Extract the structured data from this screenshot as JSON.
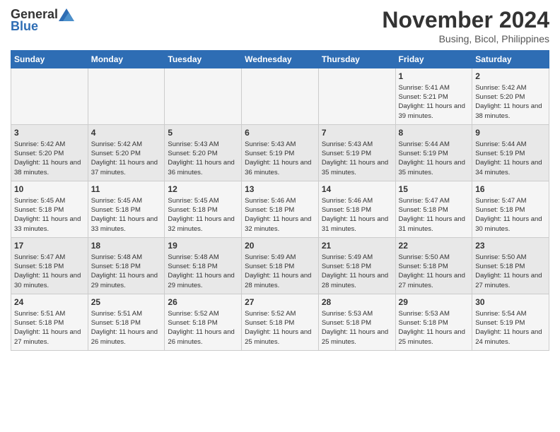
{
  "header": {
    "logo_general": "General",
    "logo_blue": "Blue",
    "month_title": "November 2024",
    "location": "Busing, Bicol, Philippines"
  },
  "days_of_week": [
    "Sunday",
    "Monday",
    "Tuesday",
    "Wednesday",
    "Thursday",
    "Friday",
    "Saturday"
  ],
  "weeks": [
    [
      {
        "day": "",
        "sunrise": "",
        "sunset": "",
        "daylight": ""
      },
      {
        "day": "",
        "sunrise": "",
        "sunset": "",
        "daylight": ""
      },
      {
        "day": "",
        "sunrise": "",
        "sunset": "",
        "daylight": ""
      },
      {
        "day": "",
        "sunrise": "",
        "sunset": "",
        "daylight": ""
      },
      {
        "day": "",
        "sunrise": "",
        "sunset": "",
        "daylight": ""
      },
      {
        "day": "1",
        "sunrise": "Sunrise: 5:41 AM",
        "sunset": "Sunset: 5:21 PM",
        "daylight": "Daylight: 11 hours and 39 minutes."
      },
      {
        "day": "2",
        "sunrise": "Sunrise: 5:42 AM",
        "sunset": "Sunset: 5:20 PM",
        "daylight": "Daylight: 11 hours and 38 minutes."
      }
    ],
    [
      {
        "day": "3",
        "sunrise": "Sunrise: 5:42 AM",
        "sunset": "Sunset: 5:20 PM",
        "daylight": "Daylight: 11 hours and 38 minutes."
      },
      {
        "day": "4",
        "sunrise": "Sunrise: 5:42 AM",
        "sunset": "Sunset: 5:20 PM",
        "daylight": "Daylight: 11 hours and 37 minutes."
      },
      {
        "day": "5",
        "sunrise": "Sunrise: 5:43 AM",
        "sunset": "Sunset: 5:20 PM",
        "daylight": "Daylight: 11 hours and 36 minutes."
      },
      {
        "day": "6",
        "sunrise": "Sunrise: 5:43 AM",
        "sunset": "Sunset: 5:19 PM",
        "daylight": "Daylight: 11 hours and 36 minutes."
      },
      {
        "day": "7",
        "sunrise": "Sunrise: 5:43 AM",
        "sunset": "Sunset: 5:19 PM",
        "daylight": "Daylight: 11 hours and 35 minutes."
      },
      {
        "day": "8",
        "sunrise": "Sunrise: 5:44 AM",
        "sunset": "Sunset: 5:19 PM",
        "daylight": "Daylight: 11 hours and 35 minutes."
      },
      {
        "day": "9",
        "sunrise": "Sunrise: 5:44 AM",
        "sunset": "Sunset: 5:19 PM",
        "daylight": "Daylight: 11 hours and 34 minutes."
      }
    ],
    [
      {
        "day": "10",
        "sunrise": "Sunrise: 5:45 AM",
        "sunset": "Sunset: 5:18 PM",
        "daylight": "Daylight: 11 hours and 33 minutes."
      },
      {
        "day": "11",
        "sunrise": "Sunrise: 5:45 AM",
        "sunset": "Sunset: 5:18 PM",
        "daylight": "Daylight: 11 hours and 33 minutes."
      },
      {
        "day": "12",
        "sunrise": "Sunrise: 5:45 AM",
        "sunset": "Sunset: 5:18 PM",
        "daylight": "Daylight: 11 hours and 32 minutes."
      },
      {
        "day": "13",
        "sunrise": "Sunrise: 5:46 AM",
        "sunset": "Sunset: 5:18 PM",
        "daylight": "Daylight: 11 hours and 32 minutes."
      },
      {
        "day": "14",
        "sunrise": "Sunrise: 5:46 AM",
        "sunset": "Sunset: 5:18 PM",
        "daylight": "Daylight: 11 hours and 31 minutes."
      },
      {
        "day": "15",
        "sunrise": "Sunrise: 5:47 AM",
        "sunset": "Sunset: 5:18 PM",
        "daylight": "Daylight: 11 hours and 31 minutes."
      },
      {
        "day": "16",
        "sunrise": "Sunrise: 5:47 AM",
        "sunset": "Sunset: 5:18 PM",
        "daylight": "Daylight: 11 hours and 30 minutes."
      }
    ],
    [
      {
        "day": "17",
        "sunrise": "Sunrise: 5:47 AM",
        "sunset": "Sunset: 5:18 PM",
        "daylight": "Daylight: 11 hours and 30 minutes."
      },
      {
        "day": "18",
        "sunrise": "Sunrise: 5:48 AM",
        "sunset": "Sunset: 5:18 PM",
        "daylight": "Daylight: 11 hours and 29 minutes."
      },
      {
        "day": "19",
        "sunrise": "Sunrise: 5:48 AM",
        "sunset": "Sunset: 5:18 PM",
        "daylight": "Daylight: 11 hours and 29 minutes."
      },
      {
        "day": "20",
        "sunrise": "Sunrise: 5:49 AM",
        "sunset": "Sunset: 5:18 PM",
        "daylight": "Daylight: 11 hours and 28 minutes."
      },
      {
        "day": "21",
        "sunrise": "Sunrise: 5:49 AM",
        "sunset": "Sunset: 5:18 PM",
        "daylight": "Daylight: 11 hours and 28 minutes."
      },
      {
        "day": "22",
        "sunrise": "Sunrise: 5:50 AM",
        "sunset": "Sunset: 5:18 PM",
        "daylight": "Daylight: 11 hours and 27 minutes."
      },
      {
        "day": "23",
        "sunrise": "Sunrise: 5:50 AM",
        "sunset": "Sunset: 5:18 PM",
        "daylight": "Daylight: 11 hours and 27 minutes."
      }
    ],
    [
      {
        "day": "24",
        "sunrise": "Sunrise: 5:51 AM",
        "sunset": "Sunset: 5:18 PM",
        "daylight": "Daylight: 11 hours and 27 minutes."
      },
      {
        "day": "25",
        "sunrise": "Sunrise: 5:51 AM",
        "sunset": "Sunset: 5:18 PM",
        "daylight": "Daylight: 11 hours and 26 minutes."
      },
      {
        "day": "26",
        "sunrise": "Sunrise: 5:52 AM",
        "sunset": "Sunset: 5:18 PM",
        "daylight": "Daylight: 11 hours and 26 minutes."
      },
      {
        "day": "27",
        "sunrise": "Sunrise: 5:52 AM",
        "sunset": "Sunset: 5:18 PM",
        "daylight": "Daylight: 11 hours and 25 minutes."
      },
      {
        "day": "28",
        "sunrise": "Sunrise: 5:53 AM",
        "sunset": "Sunset: 5:18 PM",
        "daylight": "Daylight: 11 hours and 25 minutes."
      },
      {
        "day": "29",
        "sunrise": "Sunrise: 5:53 AM",
        "sunset": "Sunset: 5:18 PM",
        "daylight": "Daylight: 11 hours and 25 minutes."
      },
      {
        "day": "30",
        "sunrise": "Sunrise: 5:54 AM",
        "sunset": "Sunset: 5:19 PM",
        "daylight": "Daylight: 11 hours and 24 minutes."
      }
    ]
  ]
}
